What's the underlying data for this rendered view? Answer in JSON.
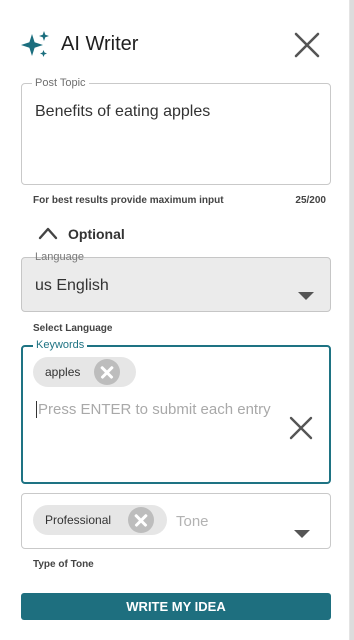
{
  "header": {
    "title": "AI Writer",
    "icon": "sparkle-icon",
    "close_icon": "close-icon"
  },
  "post_topic": {
    "legend": "Post Topic",
    "value": "Benefits of eating apples"
  },
  "hint": {
    "text": "For best results provide maximum input",
    "counter": "25/200"
  },
  "optional": {
    "label": "Optional",
    "icon": "chevron-up-icon"
  },
  "language": {
    "legend": "Language",
    "value": "us English",
    "helper": "Select Language"
  },
  "keywords": {
    "legend": "Keywords",
    "chips": [
      "apples"
    ],
    "placeholder": "Press ENTER to submit each entry"
  },
  "tone": {
    "chips": [
      "Professional"
    ],
    "placeholder": "Tone",
    "helper": "Type of Tone"
  },
  "submit": {
    "label": "WRITE MY IDEA"
  },
  "colors": {
    "accent": "#1e6f7f",
    "focus_border": "#1e7383",
    "sparkle": "#1b6e7e"
  }
}
